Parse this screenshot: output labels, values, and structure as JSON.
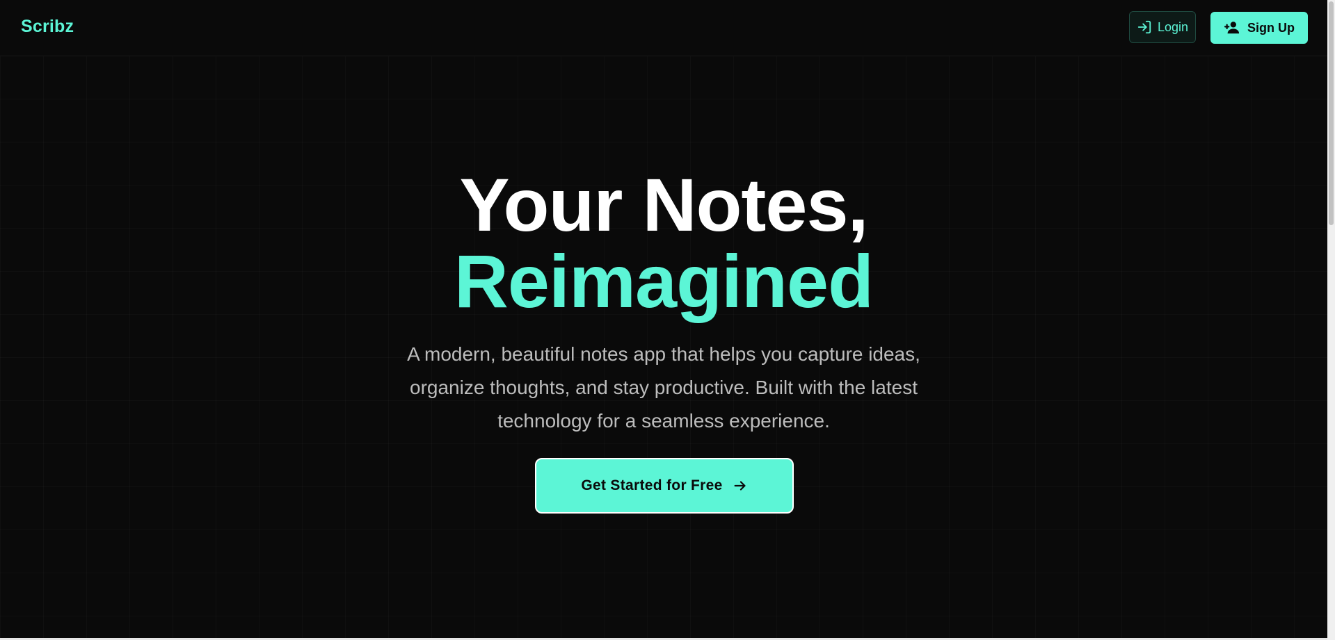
{
  "app": {
    "brand": "Scribz"
  },
  "header": {
    "login_label": "Login",
    "signup_label": "Sign Up"
  },
  "hero": {
    "headline_line1": "Your Notes,",
    "headline_line2": "Reimagined",
    "subtitle": "A modern, beautiful notes app that helps you capture ideas, organize thoughts, and stay productive. Built with the latest technology for a seamless experience.",
    "cta_label": "Get Started for Free"
  },
  "icons": {
    "login": "login-icon",
    "signup": "user-plus-icon",
    "cta": "arrow-right-icon"
  },
  "colors": {
    "accent": "#5cf5d6",
    "background": "#0a0a0a",
    "heading": "#ffffff",
    "body_text": "#bdbdbd"
  }
}
